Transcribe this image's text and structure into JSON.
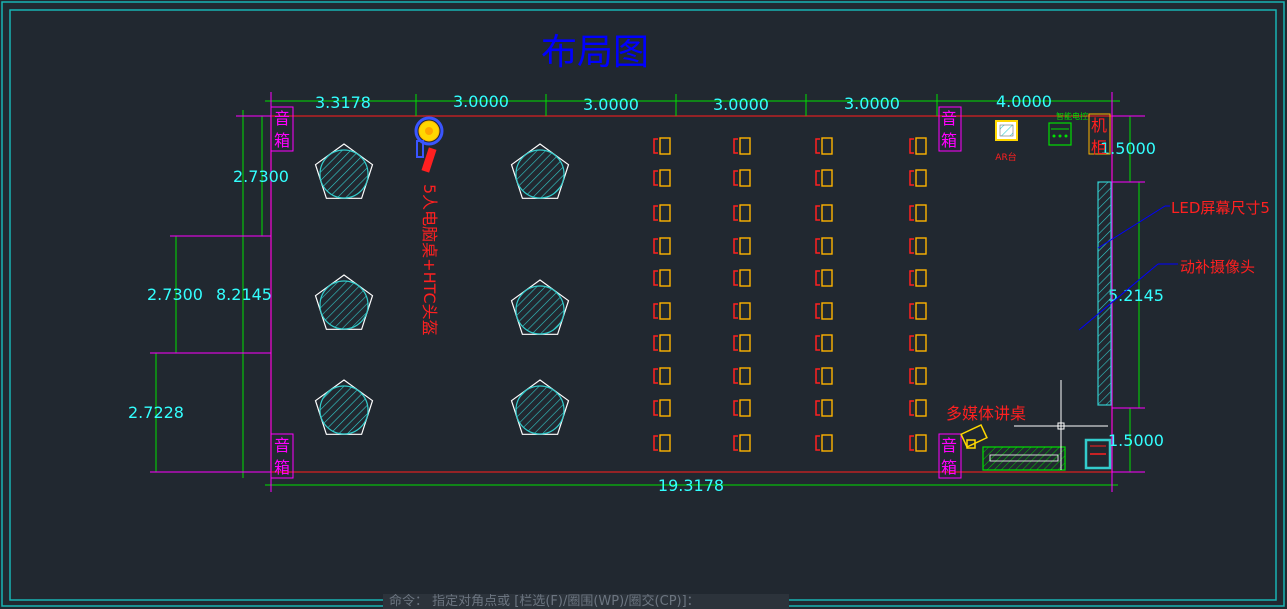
{
  "title": "布局图",
  "dimensions": {
    "top": [
      "3.3178",
      "3.0000",
      "3.0000",
      "3.0000",
      "3.0000",
      "4.0000"
    ],
    "left_outer": "2.7300",
    "left_middle": "2.7300",
    "left_lower": "2.7228",
    "left_total": "8.2145",
    "bottom_total": "19.3178",
    "right_top": "1.5000",
    "right_middle": "5.2145",
    "right_bottom": "1.5000"
  },
  "labels": {
    "speaker": [
      "音",
      "箱"
    ],
    "cabinet": [
      "机",
      "柜"
    ],
    "vr_desk": "5人电脑桌+HTC头盔",
    "ar_desk": "AR台",
    "led_screen": "LED屏幕尺寸5",
    "motion_camera": "动补摄像头",
    "podium": "多媒体讲桌",
    "top_device": "智能电控"
  },
  "seating": {
    "columns": 4,
    "rows": 10
  },
  "command_line": "命令： 指定对角点或 [栏选(F)/圈围(WP)/圈交(CP)]：",
  "colors": {
    "background": "#212830",
    "frame": "#19b3b3",
    "dimension": "#00e000",
    "dimension_text": "#33ffff",
    "wall": "#e02020",
    "magenta": "#ff00ff",
    "title": "#0000ff",
    "seat": "#ffb300",
    "seat_back": "#ff2020",
    "red_text": "#ff2020",
    "leader": "#0000ff"
  }
}
